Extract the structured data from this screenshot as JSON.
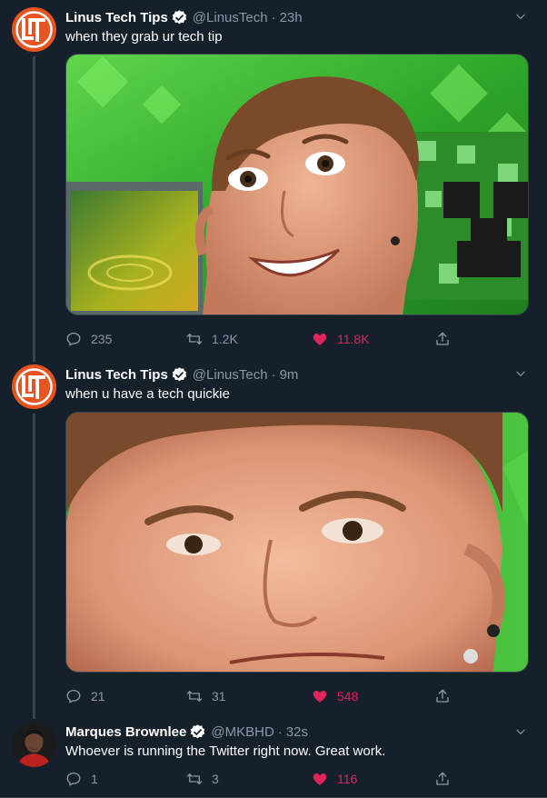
{
  "colors": {
    "background": "#15202b",
    "secondary_text": "#8899a6",
    "like_active": "#e0245e",
    "verified": "#ffffff",
    "ltt_orange": "#e8531f"
  },
  "tweets": [
    {
      "name": "Linus Tech Tips",
      "handle": "@LinusTech",
      "separator": "·",
      "time": "23h",
      "text": "when they grab ur tech tip",
      "avatar_icon": "linus-tech-tips-logo",
      "replies": "235",
      "retweets": "1.2K",
      "likes": "11.8K"
    },
    {
      "name": "Linus Tech Tips",
      "handle": "@LinusTech",
      "separator": "·",
      "time": "9m",
      "text": "when u have a tech quickie",
      "avatar_icon": "linus-tech-tips-logo",
      "replies": "21",
      "retweets": "31",
      "likes": "548"
    },
    {
      "name": "Marques Brownlee",
      "handle": "@MKBHD",
      "separator": "·",
      "time": "32s",
      "text": "Whoever is running the Twitter right now. Great work.",
      "avatar_icon": "profile-photo",
      "replies": "1",
      "retweets": "3",
      "likes": "116"
    }
  ]
}
